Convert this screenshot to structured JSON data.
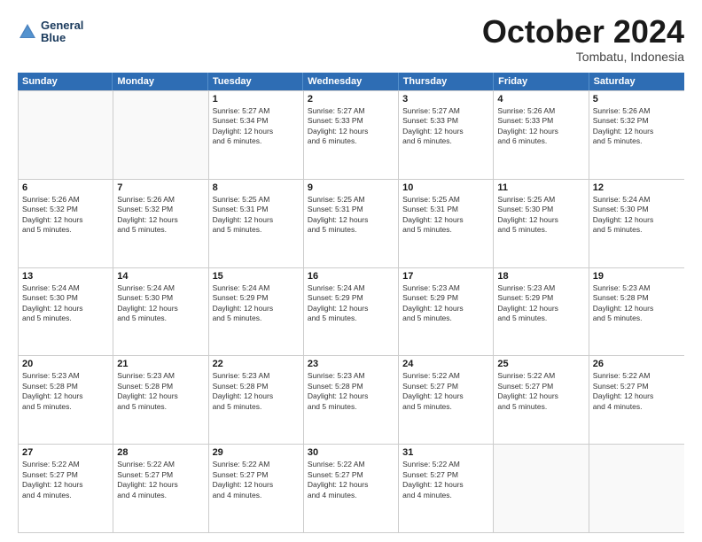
{
  "header": {
    "logo_line1": "General",
    "logo_line2": "Blue",
    "month_title": "October 2024",
    "subtitle": "Tombatu, Indonesia"
  },
  "weekdays": [
    "Sunday",
    "Monday",
    "Tuesday",
    "Wednesday",
    "Thursday",
    "Friday",
    "Saturday"
  ],
  "weeks": [
    [
      {
        "day": "",
        "info": ""
      },
      {
        "day": "",
        "info": ""
      },
      {
        "day": "1",
        "info": "Sunrise: 5:27 AM\nSunset: 5:34 PM\nDaylight: 12 hours\nand 6 minutes."
      },
      {
        "day": "2",
        "info": "Sunrise: 5:27 AM\nSunset: 5:33 PM\nDaylight: 12 hours\nand 6 minutes."
      },
      {
        "day": "3",
        "info": "Sunrise: 5:27 AM\nSunset: 5:33 PM\nDaylight: 12 hours\nand 6 minutes."
      },
      {
        "day": "4",
        "info": "Sunrise: 5:26 AM\nSunset: 5:33 PM\nDaylight: 12 hours\nand 6 minutes."
      },
      {
        "day": "5",
        "info": "Sunrise: 5:26 AM\nSunset: 5:32 PM\nDaylight: 12 hours\nand 5 minutes."
      }
    ],
    [
      {
        "day": "6",
        "info": "Sunrise: 5:26 AM\nSunset: 5:32 PM\nDaylight: 12 hours\nand 5 minutes."
      },
      {
        "day": "7",
        "info": "Sunrise: 5:26 AM\nSunset: 5:32 PM\nDaylight: 12 hours\nand 5 minutes."
      },
      {
        "day": "8",
        "info": "Sunrise: 5:25 AM\nSunset: 5:31 PM\nDaylight: 12 hours\nand 5 minutes."
      },
      {
        "day": "9",
        "info": "Sunrise: 5:25 AM\nSunset: 5:31 PM\nDaylight: 12 hours\nand 5 minutes."
      },
      {
        "day": "10",
        "info": "Sunrise: 5:25 AM\nSunset: 5:31 PM\nDaylight: 12 hours\nand 5 minutes."
      },
      {
        "day": "11",
        "info": "Sunrise: 5:25 AM\nSunset: 5:30 PM\nDaylight: 12 hours\nand 5 minutes."
      },
      {
        "day": "12",
        "info": "Sunrise: 5:24 AM\nSunset: 5:30 PM\nDaylight: 12 hours\nand 5 minutes."
      }
    ],
    [
      {
        "day": "13",
        "info": "Sunrise: 5:24 AM\nSunset: 5:30 PM\nDaylight: 12 hours\nand 5 minutes."
      },
      {
        "day": "14",
        "info": "Sunrise: 5:24 AM\nSunset: 5:30 PM\nDaylight: 12 hours\nand 5 minutes."
      },
      {
        "day": "15",
        "info": "Sunrise: 5:24 AM\nSunset: 5:29 PM\nDaylight: 12 hours\nand 5 minutes."
      },
      {
        "day": "16",
        "info": "Sunrise: 5:24 AM\nSunset: 5:29 PM\nDaylight: 12 hours\nand 5 minutes."
      },
      {
        "day": "17",
        "info": "Sunrise: 5:23 AM\nSunset: 5:29 PM\nDaylight: 12 hours\nand 5 minutes."
      },
      {
        "day": "18",
        "info": "Sunrise: 5:23 AM\nSunset: 5:29 PM\nDaylight: 12 hours\nand 5 minutes."
      },
      {
        "day": "19",
        "info": "Sunrise: 5:23 AM\nSunset: 5:28 PM\nDaylight: 12 hours\nand 5 minutes."
      }
    ],
    [
      {
        "day": "20",
        "info": "Sunrise: 5:23 AM\nSunset: 5:28 PM\nDaylight: 12 hours\nand 5 minutes."
      },
      {
        "day": "21",
        "info": "Sunrise: 5:23 AM\nSunset: 5:28 PM\nDaylight: 12 hours\nand 5 minutes."
      },
      {
        "day": "22",
        "info": "Sunrise: 5:23 AM\nSunset: 5:28 PM\nDaylight: 12 hours\nand 5 minutes."
      },
      {
        "day": "23",
        "info": "Sunrise: 5:23 AM\nSunset: 5:28 PM\nDaylight: 12 hours\nand 5 minutes."
      },
      {
        "day": "24",
        "info": "Sunrise: 5:22 AM\nSunset: 5:27 PM\nDaylight: 12 hours\nand 5 minutes."
      },
      {
        "day": "25",
        "info": "Sunrise: 5:22 AM\nSunset: 5:27 PM\nDaylight: 12 hours\nand 5 minutes."
      },
      {
        "day": "26",
        "info": "Sunrise: 5:22 AM\nSunset: 5:27 PM\nDaylight: 12 hours\nand 4 minutes."
      }
    ],
    [
      {
        "day": "27",
        "info": "Sunrise: 5:22 AM\nSunset: 5:27 PM\nDaylight: 12 hours\nand 4 minutes."
      },
      {
        "day": "28",
        "info": "Sunrise: 5:22 AM\nSunset: 5:27 PM\nDaylight: 12 hours\nand 4 minutes."
      },
      {
        "day": "29",
        "info": "Sunrise: 5:22 AM\nSunset: 5:27 PM\nDaylight: 12 hours\nand 4 minutes."
      },
      {
        "day": "30",
        "info": "Sunrise: 5:22 AM\nSunset: 5:27 PM\nDaylight: 12 hours\nand 4 minutes."
      },
      {
        "day": "31",
        "info": "Sunrise: 5:22 AM\nSunset: 5:27 PM\nDaylight: 12 hours\nand 4 minutes."
      },
      {
        "day": "",
        "info": ""
      },
      {
        "day": "",
        "info": ""
      }
    ]
  ]
}
